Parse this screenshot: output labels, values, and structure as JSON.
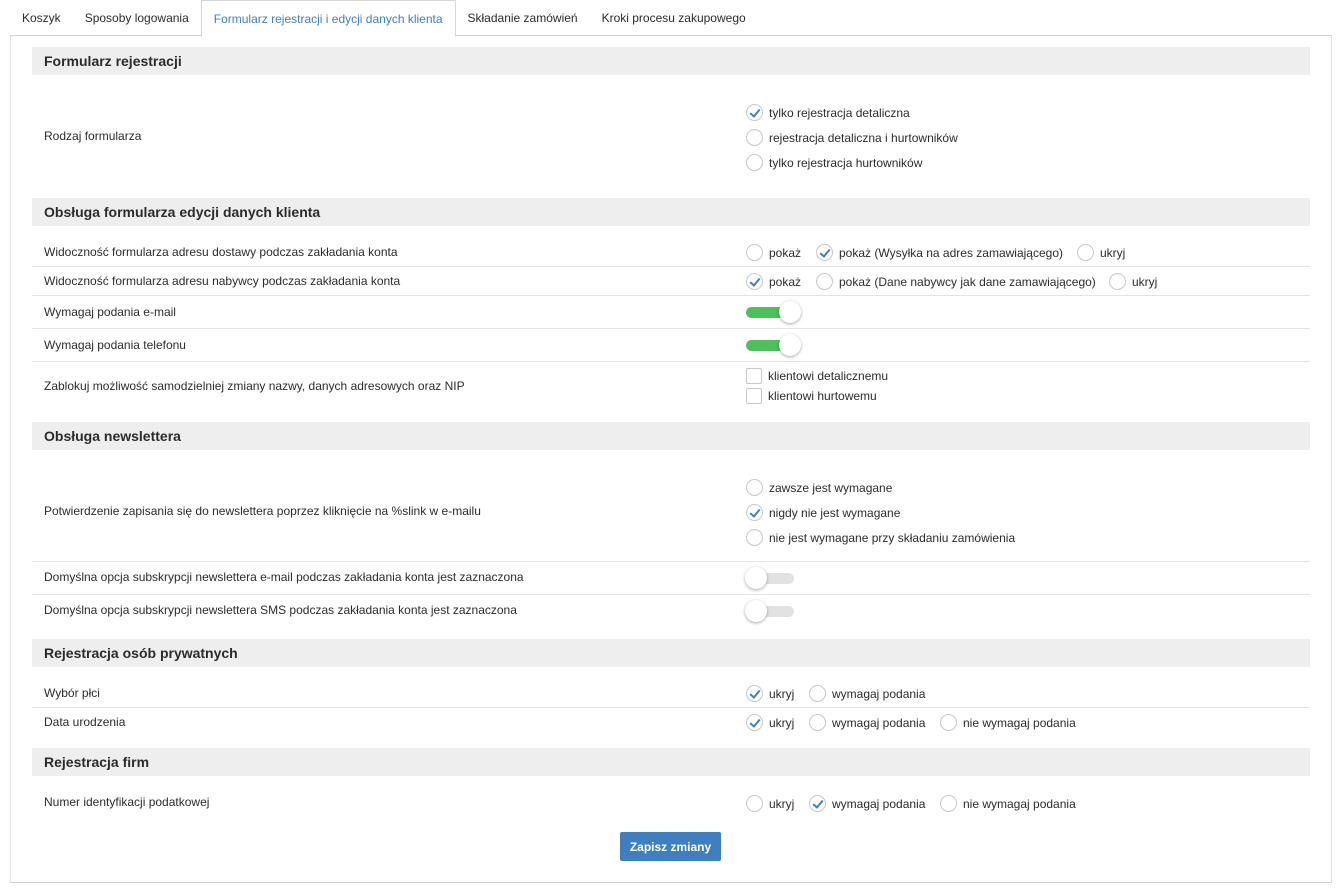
{
  "tabs": [
    "Koszyk",
    "Sposoby logowania",
    "Formularz rejestracji i edycji danych klienta",
    "Składanie zamówień",
    "Kroki procesu zakupowego"
  ],
  "active_tab": 2,
  "sections": {
    "registration": {
      "title": "Formularz rejestracji",
      "form_type": {
        "label": "Rodzaj formularza",
        "options": [
          "tylko rejestracja detaliczna",
          "rejestracja detaliczna i hurtowników",
          "tylko rejestracja hurtowników"
        ],
        "selected": 0
      }
    },
    "edit": {
      "title": "Obsługa formularza edycji danych klienta",
      "delivery": {
        "label": "Widoczność formularza adresu dostawy podczas zakładania konta",
        "options": [
          "pokaż",
          "pokaż (Wysyłka na adres zamawiającego)",
          "ukryj"
        ],
        "selected": 1
      },
      "buyer": {
        "label": "Widoczność formularza adresu nabywcy podczas zakładania konta",
        "options": [
          "pokaż",
          "pokaż (Dane nabywcy jak dane zamawiającego)",
          "ukryj"
        ],
        "selected": 0
      },
      "require_email": {
        "label": "Wymagaj podania e-mail",
        "on": true
      },
      "require_phone": {
        "label": "Wymagaj podania telefonu",
        "on": true
      },
      "lock": {
        "label": "Zablokuj możliwość samodzielniej zmiany nazwy, danych adresowych oraz NIP",
        "options": [
          "klientowi detalicznemu",
          "klientowi hurtowemu"
        ]
      }
    },
    "newsletter": {
      "title": "Obsługa newslettera",
      "confirm": {
        "label": "Potwierdzenie zapisania się do newslettera poprzez kliknięcie na %slink w e-mailu",
        "options": [
          "zawsze jest wymagane",
          "nigdy nie jest wymagane",
          "nie jest wymagane przy składaniu zamówienia"
        ],
        "selected": 1
      },
      "default_email": {
        "label": "Domyślna opcja subskrypcji newslettera e-mail podczas zakładania konta jest zaznaczona",
        "on": false
      },
      "default_sms": {
        "label": "Domyślna opcja subskrypcji newslettera SMS podczas zakładania konta jest zaznaczona",
        "on": false
      }
    },
    "private": {
      "title": "Rejestracja osób prywatnych",
      "gender": {
        "label": "Wybór płci",
        "options": [
          "ukryj",
          "wymagaj podania"
        ],
        "selected": 0
      },
      "birthdate": {
        "label": "Data urodzenia",
        "options": [
          "ukryj",
          "wymagaj podania",
          "nie wymagaj podania"
        ],
        "selected": 0
      }
    },
    "company": {
      "title": "Rejestracja firm",
      "tax_id": {
        "label": "Numer identyfikacji podatkowej",
        "options": [
          "ukryj",
          "wymagaj podania",
          "nie wymagaj podania"
        ],
        "selected": 1
      }
    }
  },
  "save_label": "Zapisz zmiany",
  "colors": {
    "accent": "#3d7fbf",
    "toggle_on": "#4cc15a",
    "header_bg": "#eeeeee"
  }
}
